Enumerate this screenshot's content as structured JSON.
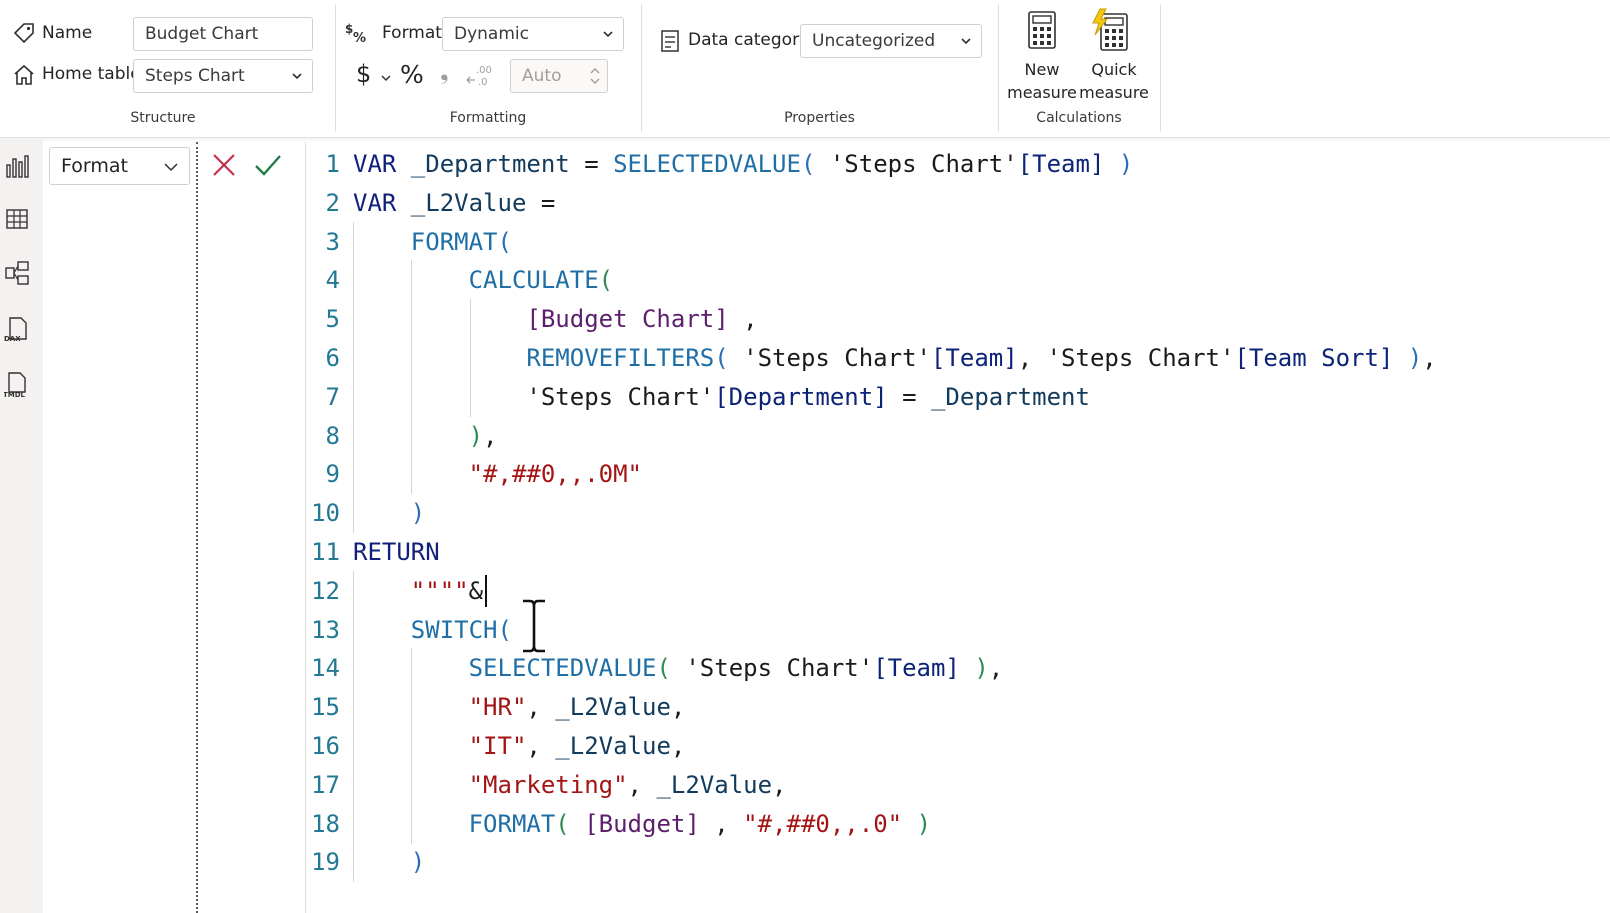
{
  "ribbon": {
    "structure": {
      "name_label": "Name",
      "name_value": "Budget Chart",
      "home_table_label": "Home table",
      "home_table_value": "Steps Chart",
      "group_label": "Structure"
    },
    "formatting": {
      "format_label": "Format",
      "format_value": "Dynamic",
      "currency_symbol": "$",
      "percent_symbol": "%",
      "comma_symbol": "❟",
      "decimals_value": "Auto",
      "group_label": "Formatting"
    },
    "properties": {
      "data_category_label": "Data category",
      "data_category_value": "Uncategorized",
      "group_label": "Properties"
    },
    "calculations": {
      "new_measure_line1": "New",
      "new_measure_line2": "measure",
      "quick_measure_line1": "Quick",
      "quick_measure_line2": "measure",
      "group_label": "Calculations"
    }
  },
  "formula_bar": {
    "property_value": "Format"
  },
  "code": {
    "line_numbers": [
      "1",
      "2",
      "3",
      "4",
      "5",
      "6",
      "7",
      "8",
      "9",
      "10",
      "11",
      "12",
      "13",
      "14",
      "15",
      "16",
      "17",
      "18",
      "19"
    ],
    "lines": [
      [
        [
          "kw",
          "VAR "
        ],
        [
          "var",
          "_Department"
        ],
        [
          "op",
          " = "
        ],
        [
          "fn",
          "SELECTEDVALUE"
        ],
        [
          "p1",
          "("
        ],
        [
          "op",
          " "
        ],
        [
          "tbl",
          "'Steps Chart'"
        ],
        [
          "col",
          "[Team]"
        ],
        [
          "op",
          " "
        ],
        [
          "p1",
          ")"
        ]
      ],
      [
        [
          "kw",
          "VAR "
        ],
        [
          "var",
          "_L2Value"
        ],
        [
          "op",
          " ="
        ]
      ],
      [
        [
          "op",
          "    "
        ],
        [
          "fn",
          "FORMAT"
        ],
        [
          "p1",
          "("
        ]
      ],
      [
        [
          "op",
          "        "
        ],
        [
          "fn",
          "CALCULATE"
        ],
        [
          "p2",
          "("
        ]
      ],
      [
        [
          "op",
          "            "
        ],
        [
          "msr",
          "[Budget Chart]"
        ],
        [
          "op",
          " ,"
        ]
      ],
      [
        [
          "op",
          "            "
        ],
        [
          "fn",
          "REMOVEFILTERS"
        ],
        [
          "p1",
          "("
        ],
        [
          "op",
          " "
        ],
        [
          "tbl",
          "'Steps Chart'"
        ],
        [
          "col",
          "[Team]"
        ],
        [
          "op",
          ", "
        ],
        [
          "tbl",
          "'Steps Chart'"
        ],
        [
          "col",
          "[Team Sort]"
        ],
        [
          "op",
          " "
        ],
        [
          "p1",
          ")"
        ],
        [
          "op",
          ","
        ]
      ],
      [
        [
          "op",
          "            "
        ],
        [
          "tbl",
          "'Steps Chart'"
        ],
        [
          "col",
          "[Department]"
        ],
        [
          "op",
          " = "
        ],
        [
          "var",
          "_Department"
        ]
      ],
      [
        [
          "op",
          "        "
        ],
        [
          "p2",
          ")"
        ],
        [
          "op",
          ","
        ]
      ],
      [
        [
          "op",
          "        "
        ],
        [
          "str",
          "\"#,##0,,.0M\""
        ]
      ],
      [
        [
          "op",
          "    "
        ],
        [
          "p1",
          ")"
        ]
      ],
      [
        [
          "kw",
          "RETURN"
        ]
      ],
      [
        [
          "op",
          "    "
        ],
        [
          "str",
          "\"\"\"\""
        ],
        [
          "op",
          "&"
        ]
      ],
      [
        [
          "op",
          "    "
        ],
        [
          "fn",
          "SWITCH"
        ],
        [
          "p1",
          "("
        ]
      ],
      [
        [
          "op",
          "        "
        ],
        [
          "fn",
          "SELECTEDVALUE"
        ],
        [
          "p2",
          "("
        ],
        [
          "op",
          " "
        ],
        [
          "tbl",
          "'Steps Chart'"
        ],
        [
          "col",
          "[Team]"
        ],
        [
          "op",
          " "
        ],
        [
          "p2",
          ")"
        ],
        [
          "op",
          ","
        ]
      ],
      [
        [
          "op",
          "        "
        ],
        [
          "str",
          "\"HR\""
        ],
        [
          "op",
          ", "
        ],
        [
          "var",
          "_L2Value"
        ],
        [
          "op",
          ","
        ]
      ],
      [
        [
          "op",
          "        "
        ],
        [
          "str",
          "\"IT\""
        ],
        [
          "op",
          ", "
        ],
        [
          "var",
          "_L2Value"
        ],
        [
          "op",
          ","
        ]
      ],
      [
        [
          "op",
          "        "
        ],
        [
          "str",
          "\"Marketing\""
        ],
        [
          "op",
          ", "
        ],
        [
          "var",
          "_L2Value"
        ],
        [
          "op",
          ","
        ]
      ],
      [
        [
          "op",
          "        "
        ],
        [
          "fn",
          "FORMAT"
        ],
        [
          "p2",
          "("
        ],
        [
          "op",
          " "
        ],
        [
          "msr",
          "[Budget]"
        ],
        [
          "op",
          " , "
        ],
        [
          "str",
          "\"#,##0,,.0\""
        ],
        [
          "op",
          " "
        ],
        [
          "p2",
          ")"
        ]
      ],
      [
        [
          "op",
          "    "
        ],
        [
          "p1",
          ")"
        ]
      ]
    ]
  },
  "colors": {
    "keyword": "#0f1f7a",
    "function": "#1f6fa6",
    "string": "#a31515",
    "line_number": "#237893",
    "measure": "#5c1f6b"
  }
}
